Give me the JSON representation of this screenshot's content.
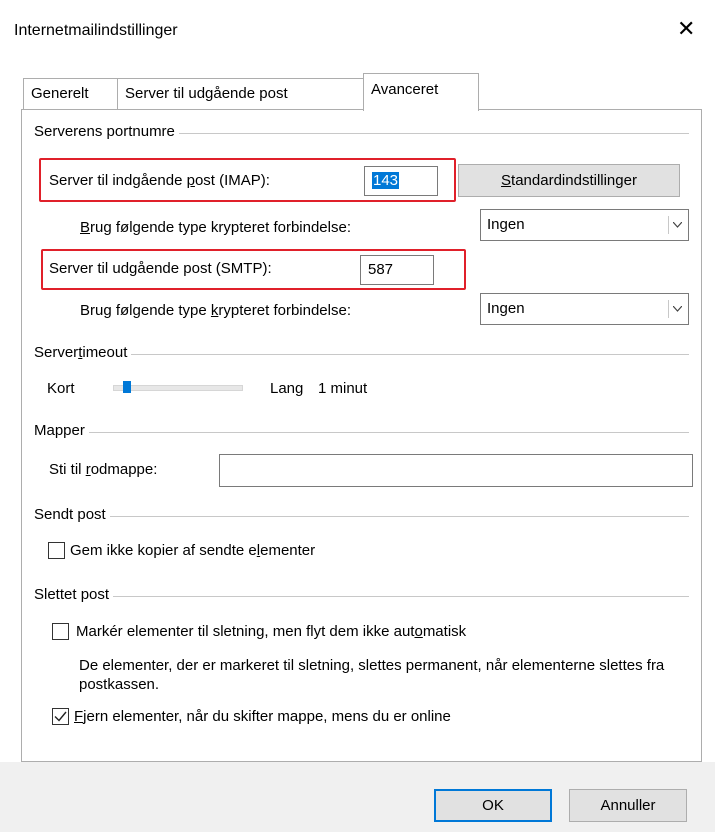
{
  "window": {
    "title": "Internetmailindstillinger"
  },
  "tabs": [
    {
      "label": "Generelt"
    },
    {
      "label": "Server til udgående post"
    },
    {
      "label": "Avanceret"
    }
  ],
  "ports": {
    "group_title": "Serverens portnumre",
    "incoming_label": "Server til indgående post (IMAP):",
    "incoming_value": "143",
    "defaults_button": "Standardindstillinger",
    "incoming_encryption_label": "Brug følgende type krypteret forbindelse:",
    "incoming_encryption_value": "Ingen",
    "outgoing_label": "Server til udgående post (SMTP):",
    "outgoing_value": "587",
    "outgoing_encryption_label": "Brug følgende type krypteret forbindelse:",
    "outgoing_encryption_value": "Ingen"
  },
  "timeout": {
    "group_title": "Servertimeout",
    "short_label": "Kort",
    "long_label": "Lang",
    "value_text": "1 minut",
    "slider_level": 0.08
  },
  "folders": {
    "group_title": "Mapper",
    "root_label": "Sti til rodmappe:",
    "root_value": ""
  },
  "sent": {
    "group_title": "Sendt post",
    "no_copies_label": "Gem ikke kopier af sendte elementer",
    "no_copies_checked": false
  },
  "deleted": {
    "group_title": "Slettet post",
    "mark_label": "Markér elementer til sletning, men flyt dem ikke automatisk",
    "mark_checked": false,
    "mark_description": "De elementer, der er markeret til sletning, slettes permanent, når elementerne slettes fra postkassen.",
    "purge_label": "Fjern elementer, når du skifter mappe, mens du er online",
    "purge_checked": true
  },
  "buttons": {
    "ok": "OK",
    "cancel": "Annuller"
  },
  "colors": {
    "accent": "#0078d7",
    "highlight": "#e0202a"
  }
}
